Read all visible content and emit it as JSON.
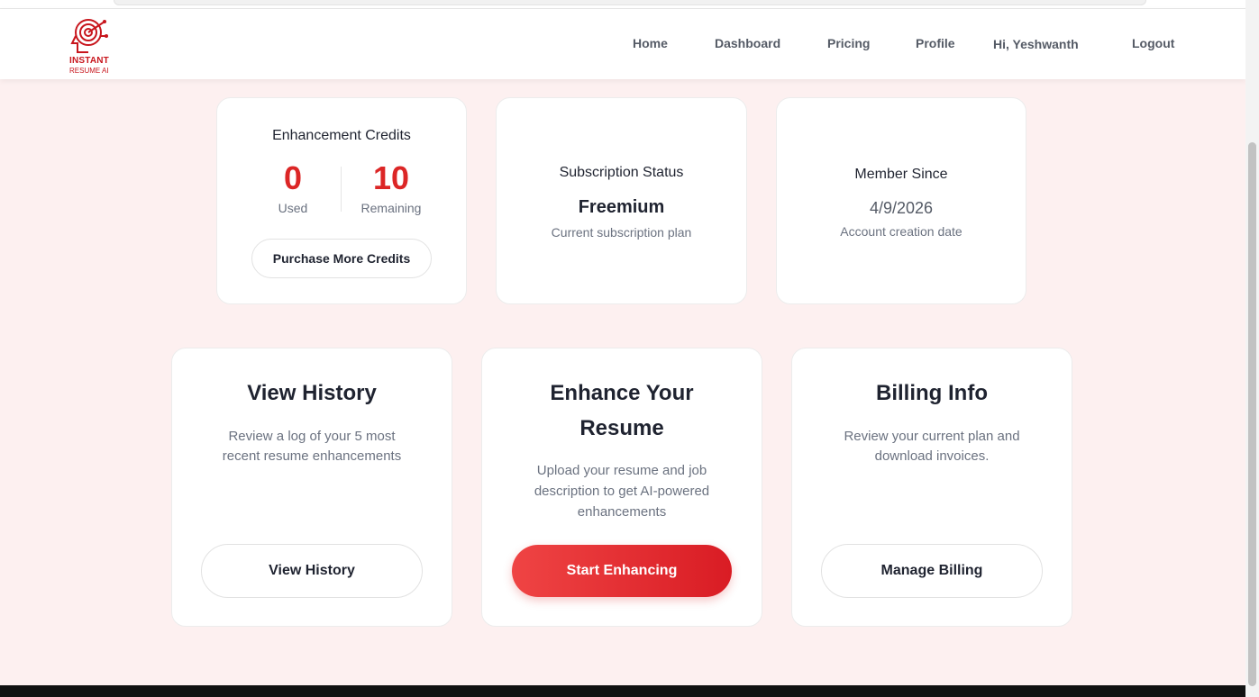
{
  "brand": {
    "line1": "INSTANT",
    "line2": "RESUME AI",
    "color": "#c8161d"
  },
  "nav": {
    "home": "Home",
    "dashboard": "Dashboard",
    "pricing": "Pricing",
    "profile": "Profile",
    "greeting": "Hi, Yeshwanth",
    "logout": "Logout"
  },
  "credits": {
    "title": "Enhancement Credits",
    "used_value": "0",
    "used_label": "Used",
    "remaining_value": "10",
    "remaining_label": "Remaining",
    "purchase_label": "Purchase More Credits"
  },
  "subscription": {
    "title": "Subscription Status",
    "plan": "Freemium",
    "caption": "Current subscription plan"
  },
  "member": {
    "title": "Member Since",
    "date": "4/9/2026",
    "caption": "Account creation date"
  },
  "history": {
    "title": "View History",
    "line1": "Review a log of your 5 most",
    "line2": "recent resume enhancements",
    "button": "View History"
  },
  "enhance": {
    "title_line1": "Enhance Your",
    "title_line2": "Resume",
    "line1": "Upload your resume and job",
    "line2": "description to get AI-powered",
    "line3": "enhancements",
    "button": "Start Enhancing"
  },
  "billing": {
    "title": "Billing Info",
    "line1": "Review your current plan and",
    "line2": "download invoices.",
    "button": "Manage Billing"
  },
  "colors": {
    "accent": "#dc2626",
    "page_bg": "#fdf0f0"
  }
}
